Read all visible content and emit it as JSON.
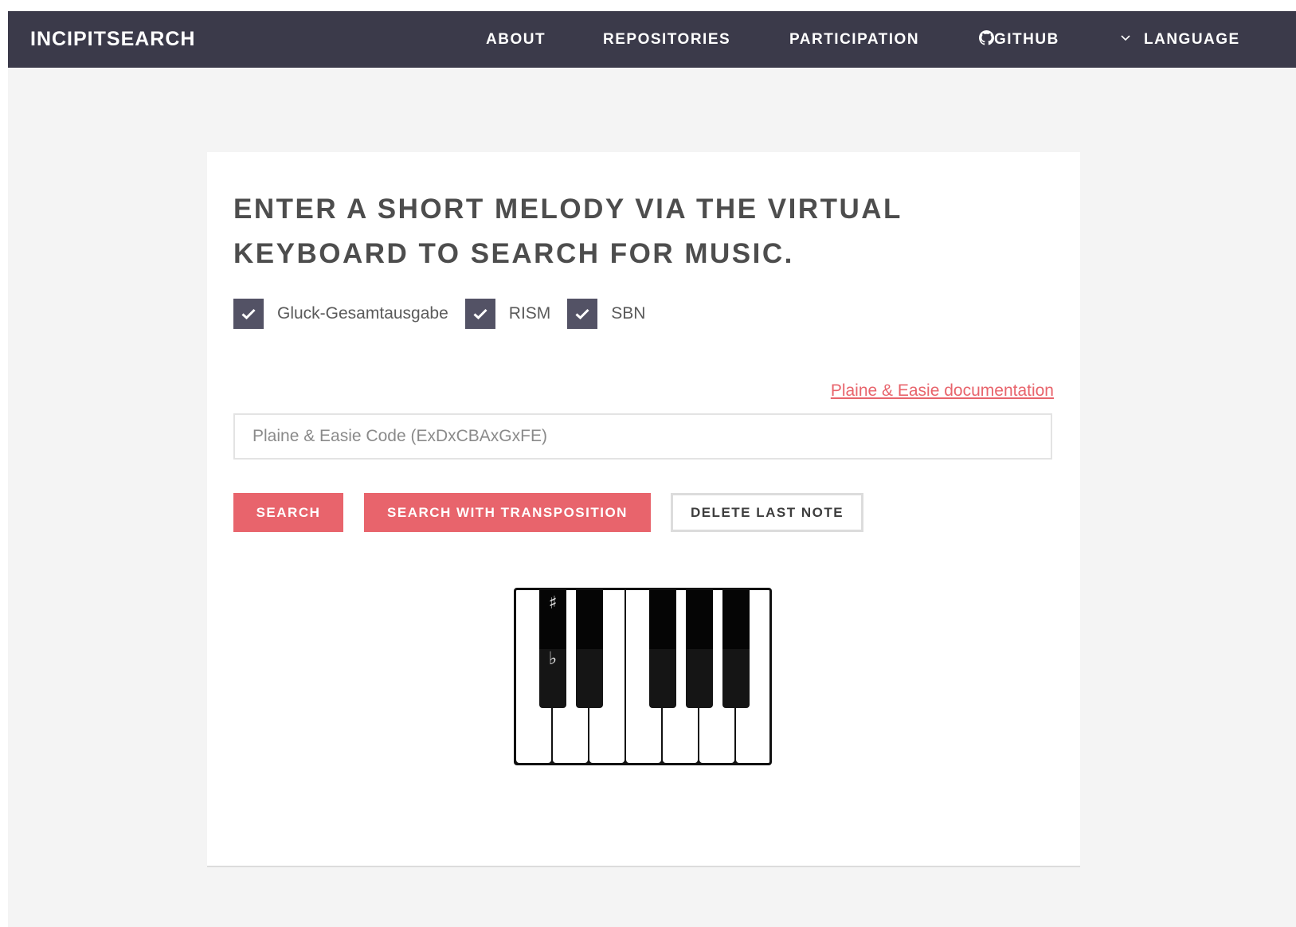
{
  "nav": {
    "brand": "INCIPITSEARCH",
    "about": "ABOUT",
    "repositories": "REPOSITORIES",
    "participation": "PARTICIPATION",
    "github": "GITHUB",
    "language": "LANGUAGE"
  },
  "main": {
    "title": "ENTER A SHORT MELODY VIA THE VIRTUAL KEYBOARD TO SEARCH FOR MUSIC.",
    "repositories": [
      {
        "label": "Gluck-Gesamtausgabe",
        "checked": true
      },
      {
        "label": "RISM",
        "checked": true
      },
      {
        "label": "SBN",
        "checked": true
      }
    ],
    "doc_link": "Plaine & Easie documentation",
    "input": {
      "placeholder": "Plaine & Easie Code (ExDxCBAxGxFE)",
      "value": ""
    },
    "buttons": {
      "search": "SEARCH",
      "search_transposition": "SEARCH WITH TRANSPOSITION",
      "delete_last_note": "DELETE LAST NOTE"
    }
  },
  "keyboard": {
    "sharp_symbol": "♯",
    "flat_symbol": "♭",
    "white_keys": 7,
    "black_keys": 5
  },
  "colors": {
    "nav_bg": "#3b3a4a",
    "accent": "#e8646c",
    "checkbox": "#535265",
    "page_bg": "#f4f4f4"
  }
}
